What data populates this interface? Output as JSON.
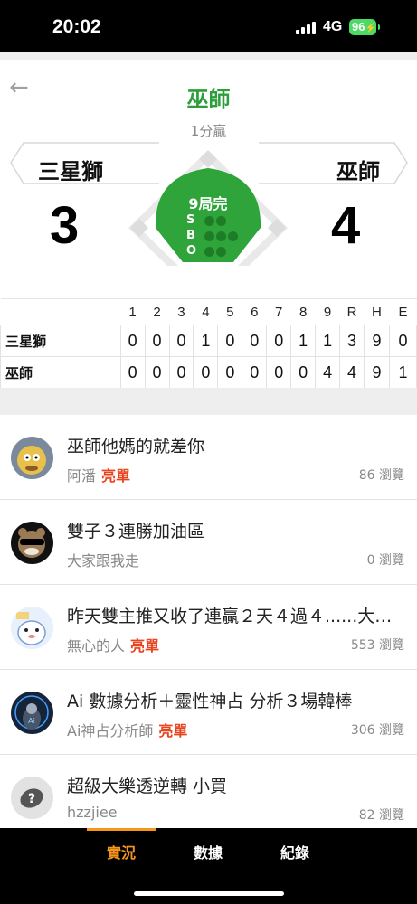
{
  "status_bar": {
    "time": "20:02",
    "network": "4G",
    "battery": "96"
  },
  "game": {
    "winner": "巫師",
    "result": "1分贏",
    "away_team": "三星獅",
    "home_team": "巫師",
    "away_score": "3",
    "home_score": "4",
    "inning": "9局完",
    "sbo": {
      "s": "S",
      "b": "B",
      "o": "O"
    }
  },
  "linescore": {
    "headers": [
      "1",
      "2",
      "3",
      "4",
      "5",
      "6",
      "7",
      "8",
      "9",
      "R",
      "H",
      "E"
    ],
    "rows": [
      {
        "team": "三星獅",
        "cells": [
          "0",
          "0",
          "0",
          "1",
          "0",
          "0",
          "0",
          "1",
          "1",
          "3",
          "9",
          "0"
        ]
      },
      {
        "team": "巫師",
        "cells": [
          "0",
          "0",
          "0",
          "0",
          "0",
          "0",
          "0",
          "0",
          "4",
          "4",
          "9",
          "1"
        ]
      }
    ]
  },
  "posts": [
    {
      "title": "巫師他媽的就差你",
      "author": "阿潘",
      "badge": "亮單",
      "views": "86 瀏覽"
    },
    {
      "title": "雙子３連勝加油區",
      "author": "大家跟我走",
      "badge": "",
      "views": "0 瀏覽"
    },
    {
      "title": "昨天雙主推又收了連贏２天４過４......大…",
      "author": "無心的人",
      "badge": "亮單",
      "views": "553 瀏覽"
    },
    {
      "title": "Ai 數據分析＋靈性神占 分析３場韓棒",
      "author": "Ai神占分析師",
      "badge": "亮單",
      "views": "306 瀏覽"
    },
    {
      "title": "超級大樂透逆轉 小買",
      "author": "hzzjiee",
      "badge": "",
      "views": "82 瀏覽"
    }
  ],
  "tabs": [
    "實況",
    "數據",
    "紀錄"
  ],
  "colors": {
    "win_green": "#2e9e3a",
    "accent_orange": "#f7961c",
    "badge_red": "#e8431d"
  }
}
